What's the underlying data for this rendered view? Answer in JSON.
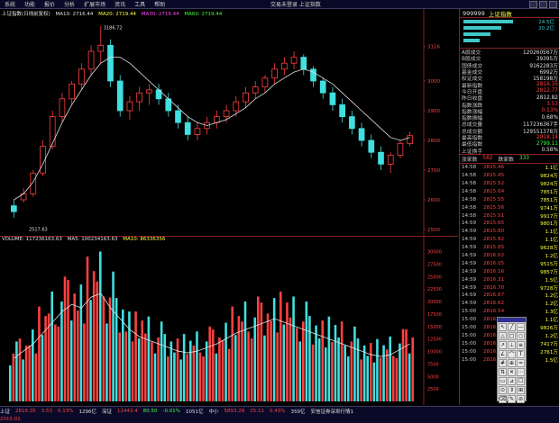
{
  "menu": {
    "items": [
      "系统",
      "功能",
      "报价",
      "分析",
      "扩展市场",
      "资讯",
      "工具",
      "帮助"
    ],
    "window_title": "交易未登录  上证指数"
  },
  "price_legend": {
    "title": "上证指数(日线前复权)",
    "ma10": "MA10: 2716.44",
    "ma20": "MA20: 2719.44",
    "ma30": "MA30: 2716.44",
    "ma60": "MA60: 2719.44"
  },
  "price_annotations": {
    "high_label": "3186.72",
    "low_label": "2517.63"
  },
  "vol_legend": {
    "title": "VOLUME: 117236163.63",
    "ma5": "MA5: 100234163.63",
    "ma10": "MA10: 86336356"
  },
  "price_axis": [
    "3116",
    "3000",
    "2900",
    "2800",
    "2700",
    "2600",
    "2500"
  ],
  "vol_axis": [
    "30000",
    "27500",
    "25000",
    "22500",
    "20000",
    "17500",
    "15000",
    "12500",
    "10000",
    "7500",
    "5000",
    "2500"
  ],
  "right_panel": {
    "code": "999999",
    "name": "上证指数",
    "orderbook": [
      {
        "label": "",
        "value": "24.5亿",
        "bar": 55
      },
      {
        "label": "",
        "value": "20.2亿",
        "bar": 42
      },
      {
        "label": "",
        "value": "",
        "bar": 30
      },
      {
        "label": "",
        "value": "",
        "bar": 18
      }
    ],
    "stats": [
      {
        "label": "A股成交",
        "value": "120260567万",
        "color": "#e0e0e0"
      },
      {
        "label": "B股成交",
        "value": "39395万",
        "color": "#e0e0e0"
      },
      {
        "label": "国债成交",
        "value": "9162283万",
        "color": "#e0e0e0"
      },
      {
        "label": "基金成交",
        "value": "6992万",
        "color": "#e0e0e0"
      },
      {
        "label": "权证成交",
        "value": "158198万",
        "color": "#e0e0e0"
      },
      {
        "label": "最新指数",
        "value": "2816.35",
        "color": "#ff4040"
      },
      {
        "label": "今日开盘",
        "value": "2812.77",
        "color": "#ff4040"
      },
      {
        "label": "昨日收盘",
        "value": "2812.82",
        "color": "#e0e0e0"
      },
      {
        "label": "指数涨跌",
        "value": "3.53",
        "color": "#ff4040"
      },
      {
        "label": "指数涨幅",
        "value": "0.13%",
        "color": "#ff4040"
      },
      {
        "label": "指数振幅",
        "value": "0.68%",
        "color": "#e0e0e0"
      },
      {
        "label": "总成交量",
        "value": "117236367手",
        "color": "#e0e0e0"
      },
      {
        "label": "总成交额",
        "value": "129551378万",
        "color": "#e0e0e0"
      },
      {
        "label": "最高指数",
        "value": "2818.14",
        "color": "#ff4040"
      },
      {
        "label": "最低指数",
        "value": "2799.11",
        "color": "#40ff40"
      },
      {
        "label": "上证换手",
        "value": "0.58%",
        "color": "#e0e0e0"
      }
    ],
    "tick_header": {
      "rise": "涨家数",
      "rise_count": "582",
      "fall": "跌家数",
      "fall_count": "333"
    },
    "ticks": [
      {
        "time": "14:58",
        "price": "2815.46",
        "vol": "1.1亿"
      },
      {
        "time": "14:58",
        "price": "2815.45",
        "vol": "9824万"
      },
      {
        "time": "14:58",
        "price": "2815.52",
        "vol": "9824万"
      },
      {
        "time": "14:58",
        "price": "2815.64",
        "vol": "7851万"
      },
      {
        "time": "14:58",
        "price": "2815.55",
        "vol": "7851万"
      },
      {
        "time": "14:58",
        "price": "2815.56",
        "vol": "9741万"
      },
      {
        "time": "14:58",
        "price": "2815.51",
        "vol": "9917万"
      },
      {
        "time": "14:59",
        "price": "2815.65",
        "vol": "9801万"
      },
      {
        "time": "14:59",
        "price": "2815.80",
        "vol": "1.1亿"
      },
      {
        "time": "14:59",
        "price": "2815.82",
        "vol": "1.1亿"
      },
      {
        "time": "14:59",
        "price": "2815.85",
        "vol": "9628万"
      },
      {
        "time": "14:59",
        "price": "2816.02",
        "vol": "1.2亿"
      },
      {
        "time": "14:59",
        "price": "2816.05",
        "vol": "9515万"
      },
      {
        "time": "14:59",
        "price": "2816.16",
        "vol": "9857万"
      },
      {
        "time": "14:59",
        "price": "2816.31",
        "vol": "1.5亿"
      },
      {
        "time": "14:59",
        "price": "2816.70",
        "vol": "9728万"
      },
      {
        "time": "14:59",
        "price": "2816.67",
        "vol": "1.2亿"
      },
      {
        "time": "14:59",
        "price": "2816.62",
        "vol": "1.2亿"
      },
      {
        "time": "15:00",
        "price": "2816.54",
        "vol": "1.3亿"
      },
      {
        "time": "15:00",
        "price": "2816.53",
        "vol": "1.1亿"
      },
      {
        "time": "15:00",
        "price": "2816.49",
        "vol": "9826万"
      },
      {
        "time": "15:00",
        "price": "2816.45",
        "vol": "1.2亿"
      },
      {
        "time": "15:00",
        "price": "2816.35",
        "vol": "7417万"
      },
      {
        "time": "15:00",
        "price": "2816.35",
        "vol": "2761万"
      },
      {
        "time": "15:00",
        "price": "2816.35",
        "vol": "1.5亿"
      }
    ]
  },
  "toolbox": {
    "tools": [
      "↖",
      "╱",
      "—",
      "△",
      "□",
      "○",
      "↗",
      "⊥",
      "≡",
      "∠",
      "⌒",
      "T",
      "#",
      "⊕",
      "≈",
      "⇅",
      "✕",
      "⋯",
      "▭",
      "⊿",
      "☐",
      "⊙",
      "⇕",
      "⊞",
      "⌫",
      "✎",
      "⊘"
    ]
  },
  "statusbar": {
    "line1": [
      {
        "text": "上证",
        "color": "#e0e0e0"
      },
      {
        "text": "2816.35",
        "color": "#ff4040"
      },
      {
        "text": "3.53",
        "color": "#ff4040"
      },
      {
        "text": "0.13%",
        "color": "#ff4040"
      },
      {
        "text": "1296亿",
        "color": "#e0e0e0"
      },
      {
        "text": "深证",
        "color": "#e0e0e0"
      },
      {
        "text": "12443.4",
        "color": "#ff4040"
      },
      {
        "text": "80.50",
        "color": "#40ff40"
      },
      {
        "text": "-0.01%",
        "color": "#40ff40"
      },
      {
        "text": "1051亿",
        "color": "#e0e0e0"
      },
      {
        "text": "中小",
        "color": "#e0e0e0"
      },
      {
        "text": "5893.28",
        "color": "#ff4040"
      },
      {
        "text": "25.11",
        "color": "#ff4040"
      },
      {
        "text": "0.43%",
        "color": "#ff4040"
      },
      {
        "text": "359亿",
        "color": "#e0e0e0"
      },
      {
        "text": "安信证券深圳行情1",
        "color": "#e0e0e0"
      }
    ],
    "line2": "2015.01"
  },
  "chart_data": {
    "type": "candlestick",
    "series": [
      {
        "name": "K",
        "values": [
          [
            2580,
            2600,
            2560,
            2540
          ],
          [
            2600,
            2640,
            2620,
            2590
          ],
          [
            2620,
            2700,
            2690,
            2610
          ],
          [
            2690,
            2800,
            2780,
            2680
          ],
          [
            2780,
            2900,
            2880,
            2770
          ],
          [
            2880,
            2960,
            2940,
            2860
          ],
          [
            2940,
            3000,
            2990,
            2920
          ],
          [
            2990,
            3060,
            3040,
            2970
          ],
          [
            3040,
            3120,
            3100,
            3020
          ],
          [
            3100,
            3186,
            3120,
            3060
          ],
          [
            3120,
            3140,
            3000,
            2980
          ],
          [
            3000,
            3020,
            2900,
            2880
          ],
          [
            2900,
            2950,
            2930,
            2870
          ],
          [
            2930,
            2980,
            2960,
            2900
          ],
          [
            2960,
            2990,
            2970,
            2920
          ],
          [
            2970,
            2990,
            2940,
            2920
          ],
          [
            2940,
            2960,
            2900,
            2880
          ],
          [
            2900,
            2920,
            2860,
            2840
          ],
          [
            2860,
            2880,
            2820,
            2800
          ],
          [
            2820,
            2860,
            2840,
            2800
          ],
          [
            2840,
            2880,
            2860,
            2820
          ],
          [
            2860,
            2900,
            2880,
            2840
          ],
          [
            2880,
            2920,
            2900,
            2860
          ],
          [
            2900,
            2950,
            2930,
            2880
          ],
          [
            2930,
            2980,
            2960,
            2910
          ],
          [
            2960,
            3000,
            2980,
            2940
          ],
          [
            2980,
            3020,
            3010,
            2960
          ],
          [
            3010,
            3060,
            3040,
            2990
          ],
          [
            3040,
            3080,
            3060,
            3020
          ],
          [
            3060,
            3100,
            3080,
            3040
          ],
          [
            3080,
            3090,
            3040,
            3020
          ],
          [
            3040,
            3050,
            3000,
            2980
          ],
          [
            3000,
            3010,
            2960,
            2940
          ],
          [
            2960,
            2980,
            2920,
            2900
          ],
          [
            2920,
            2940,
            2880,
            2860
          ],
          [
            2880,
            2900,
            2840,
            2820
          ],
          [
            2840,
            2860,
            2800,
            2780
          ],
          [
            2800,
            2820,
            2760,
            2740
          ],
          [
            2760,
            2780,
            2720,
            2700
          ],
          [
            2720,
            2760,
            2750,
            2690
          ],
          [
            2750,
            2800,
            2790,
            2740
          ],
          [
            2790,
            2830,
            2816,
            2780
          ]
        ]
      },
      {
        "name": "MA",
        "values": [
          2600,
          2620,
          2660,
          2720,
          2790,
          2860,
          2920,
          2970,
          3020,
          3060,
          3080,
          3080,
          3060,
          3030,
          3000,
          2970,
          2940,
          2910,
          2880,
          2860,
          2850,
          2860,
          2870,
          2890,
          2910,
          2940,
          2960,
          2990,
          3010,
          3030,
          3040,
          3030,
          3010,
          2990,
          2960,
          2930,
          2900,
          2870,
          2840,
          2810,
          2800,
          2810
        ]
      }
    ],
    "volume": [
      12000,
      14000,
      16000,
      19000,
      22000,
      25000,
      27000,
      26000,
      29000,
      30000,
      26000,
      23000,
      20000,
      18000,
      17000,
      16000,
      15000,
      14000,
      13500,
      14000,
      15000,
      16000,
      17500,
      19000,
      20000,
      21000,
      22000,
      23000,
      22000,
      21000,
      20000,
      19000,
      18000,
      17000,
      16000,
      15000,
      14000,
      13000,
      12500,
      13000,
      14500,
      16000
    ],
    "ylim_price": [
      2500,
      3200
    ],
    "ylim_vol": [
      0,
      31000
    ]
  }
}
